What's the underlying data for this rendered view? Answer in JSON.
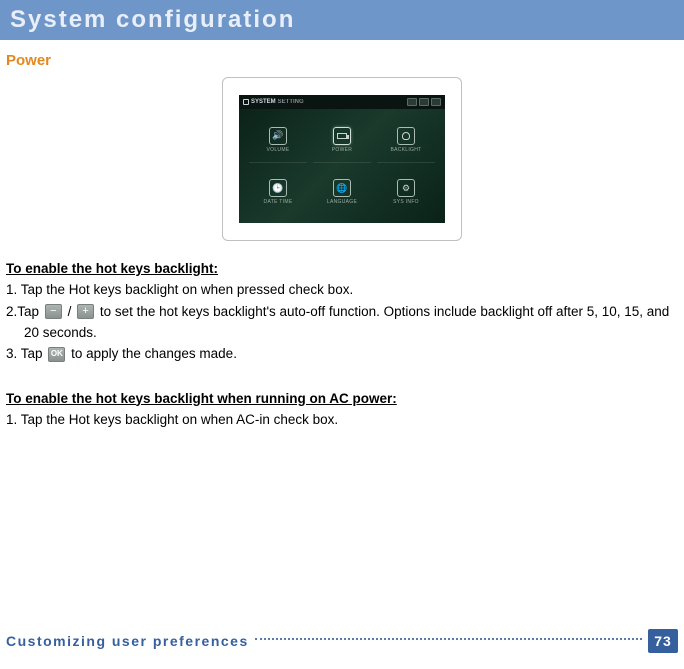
{
  "header": {
    "title": "System configuration"
  },
  "section": {
    "label": "Power"
  },
  "screenshot": {
    "topbar_label": "SYSTEM",
    "topbar_sub": "SETTING",
    "tiles": [
      {
        "label": "VOLUME"
      },
      {
        "label": "POWER"
      },
      {
        "label": "BACKLIGHT"
      },
      {
        "label": "DATE TIME"
      },
      {
        "label": "LANGUAGE"
      },
      {
        "label": "SYS INFO"
      }
    ]
  },
  "content": {
    "heading1": "To enable the hot keys backlight:",
    "step1": "1. Tap the Hot keys backlight on when pressed check box.",
    "step2_a": "2.Tap",
    "step2_b": "/",
    "step2_c": "to set the hot keys backlight's auto-off function. Options include backlight off after 5, 10, 15, and",
    "step2_d": "20 seconds.",
    "step3_a": "3. Tap",
    "step3_b": "to apply the changes made.",
    "heading2": "To enable the hot keys backlight when running on AC power:",
    "step4": "1. Tap the Hot keys backlight on when AC-in check box."
  },
  "icons": {
    "minus": "−",
    "plus": "+",
    "ok": "OK"
  },
  "footer": {
    "text": "Customizing user preferences",
    "page": "73"
  }
}
